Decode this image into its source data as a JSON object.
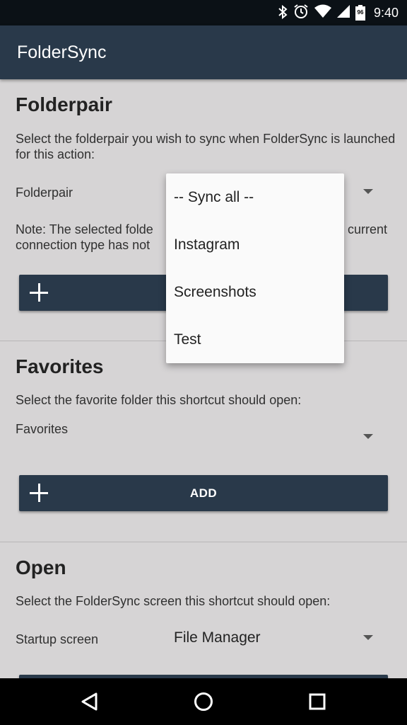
{
  "status_bar": {
    "time": "9:40",
    "battery_level": "96",
    "icons": [
      "bluetooth-icon",
      "alarm-icon",
      "wifi-icon",
      "signal-icon",
      "battery-icon"
    ]
  },
  "app_bar": {
    "title": "FolderSync"
  },
  "folderpair_section": {
    "title": "Folderpair",
    "description": "Select the folderpair you wish to sync when FolderSync is launched for this action:",
    "field_label": "Folderpair",
    "note_line1": "Note: The selected folde",
    "note_line1_tail": "current",
    "note_line2": "connection type has not",
    "add_button_label": ""
  },
  "folderpair_dropdown": {
    "options": [
      "-- Sync all --",
      "Instagram",
      "Screenshots",
      "Test"
    ]
  },
  "favorites_section": {
    "title": "Favorites",
    "description": "Select the favorite folder this shortcut should open:",
    "field_label": "Favorites",
    "add_button_label": "ADD"
  },
  "open_section": {
    "title": "Open",
    "description": "Select the FolderSync screen this shortcut should open:",
    "field_label": "Startup screen",
    "selected_value": "File Manager"
  },
  "nav_bar": {
    "icons": [
      "back-icon",
      "home-icon",
      "recents-icon"
    ]
  },
  "colors": {
    "app_bar": "#29394a",
    "background": "#d6d4d5",
    "button": "#29394a"
  }
}
